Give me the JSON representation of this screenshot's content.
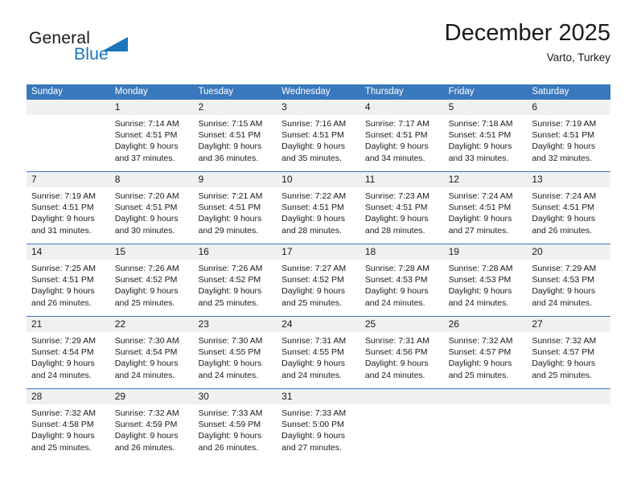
{
  "logo": {
    "text_general": "General",
    "text_blue": "Blue",
    "accent_color": "#1a75bb"
  },
  "header": {
    "title": "December 2025",
    "location": "Varto, Turkey"
  },
  "theme": {
    "header_bg": "#3a78bd",
    "daynum_bg": "#f0f0f0",
    "cell_bg": "#ffffff",
    "text": "#1a1a1a"
  },
  "calendar": {
    "weekday_headers": [
      "Sunday",
      "Monday",
      "Tuesday",
      "Wednesday",
      "Thursday",
      "Friday",
      "Saturday"
    ],
    "weeks": [
      [
        {
          "day": "",
          "lines": []
        },
        {
          "day": "1",
          "lines": [
            "Sunrise: 7:14 AM",
            "Sunset: 4:51 PM",
            "Daylight: 9 hours",
            "and 37 minutes."
          ]
        },
        {
          "day": "2",
          "lines": [
            "Sunrise: 7:15 AM",
            "Sunset: 4:51 PM",
            "Daylight: 9 hours",
            "and 36 minutes."
          ]
        },
        {
          "day": "3",
          "lines": [
            "Sunrise: 7:16 AM",
            "Sunset: 4:51 PM",
            "Daylight: 9 hours",
            "and 35 minutes."
          ]
        },
        {
          "day": "4",
          "lines": [
            "Sunrise: 7:17 AM",
            "Sunset: 4:51 PM",
            "Daylight: 9 hours",
            "and 34 minutes."
          ]
        },
        {
          "day": "5",
          "lines": [
            "Sunrise: 7:18 AM",
            "Sunset: 4:51 PM",
            "Daylight: 9 hours",
            "and 33 minutes."
          ]
        },
        {
          "day": "6",
          "lines": [
            "Sunrise: 7:19 AM",
            "Sunset: 4:51 PM",
            "Daylight: 9 hours",
            "and 32 minutes."
          ]
        }
      ],
      [
        {
          "day": "7",
          "lines": [
            "Sunrise: 7:19 AM",
            "Sunset: 4:51 PM",
            "Daylight: 9 hours",
            "and 31 minutes."
          ]
        },
        {
          "day": "8",
          "lines": [
            "Sunrise: 7:20 AM",
            "Sunset: 4:51 PM",
            "Daylight: 9 hours",
            "and 30 minutes."
          ]
        },
        {
          "day": "9",
          "lines": [
            "Sunrise: 7:21 AM",
            "Sunset: 4:51 PM",
            "Daylight: 9 hours",
            "and 29 minutes."
          ]
        },
        {
          "day": "10",
          "lines": [
            "Sunrise: 7:22 AM",
            "Sunset: 4:51 PM",
            "Daylight: 9 hours",
            "and 28 minutes."
          ]
        },
        {
          "day": "11",
          "lines": [
            "Sunrise: 7:23 AM",
            "Sunset: 4:51 PM",
            "Daylight: 9 hours",
            "and 28 minutes."
          ]
        },
        {
          "day": "12",
          "lines": [
            "Sunrise: 7:24 AM",
            "Sunset: 4:51 PM",
            "Daylight: 9 hours",
            "and 27 minutes."
          ]
        },
        {
          "day": "13",
          "lines": [
            "Sunrise: 7:24 AM",
            "Sunset: 4:51 PM",
            "Daylight: 9 hours",
            "and 26 minutes."
          ]
        }
      ],
      [
        {
          "day": "14",
          "lines": [
            "Sunrise: 7:25 AM",
            "Sunset: 4:51 PM",
            "Daylight: 9 hours",
            "and 26 minutes."
          ]
        },
        {
          "day": "15",
          "lines": [
            "Sunrise: 7:26 AM",
            "Sunset: 4:52 PM",
            "Daylight: 9 hours",
            "and 25 minutes."
          ]
        },
        {
          "day": "16",
          "lines": [
            "Sunrise: 7:26 AM",
            "Sunset: 4:52 PM",
            "Daylight: 9 hours",
            "and 25 minutes."
          ]
        },
        {
          "day": "17",
          "lines": [
            "Sunrise: 7:27 AM",
            "Sunset: 4:52 PM",
            "Daylight: 9 hours",
            "and 25 minutes."
          ]
        },
        {
          "day": "18",
          "lines": [
            "Sunrise: 7:28 AM",
            "Sunset: 4:53 PM",
            "Daylight: 9 hours",
            "and 24 minutes."
          ]
        },
        {
          "day": "19",
          "lines": [
            "Sunrise: 7:28 AM",
            "Sunset: 4:53 PM",
            "Daylight: 9 hours",
            "and 24 minutes."
          ]
        },
        {
          "day": "20",
          "lines": [
            "Sunrise: 7:29 AM",
            "Sunset: 4:53 PM",
            "Daylight: 9 hours",
            "and 24 minutes."
          ]
        }
      ],
      [
        {
          "day": "21",
          "lines": [
            "Sunrise: 7:29 AM",
            "Sunset: 4:54 PM",
            "Daylight: 9 hours",
            "and 24 minutes."
          ]
        },
        {
          "day": "22",
          "lines": [
            "Sunrise: 7:30 AM",
            "Sunset: 4:54 PM",
            "Daylight: 9 hours",
            "and 24 minutes."
          ]
        },
        {
          "day": "23",
          "lines": [
            "Sunrise: 7:30 AM",
            "Sunset: 4:55 PM",
            "Daylight: 9 hours",
            "and 24 minutes."
          ]
        },
        {
          "day": "24",
          "lines": [
            "Sunrise: 7:31 AM",
            "Sunset: 4:55 PM",
            "Daylight: 9 hours",
            "and 24 minutes."
          ]
        },
        {
          "day": "25",
          "lines": [
            "Sunrise: 7:31 AM",
            "Sunset: 4:56 PM",
            "Daylight: 9 hours",
            "and 24 minutes."
          ]
        },
        {
          "day": "26",
          "lines": [
            "Sunrise: 7:32 AM",
            "Sunset: 4:57 PM",
            "Daylight: 9 hours",
            "and 25 minutes."
          ]
        },
        {
          "day": "27",
          "lines": [
            "Sunrise: 7:32 AM",
            "Sunset: 4:57 PM",
            "Daylight: 9 hours",
            "and 25 minutes."
          ]
        }
      ],
      [
        {
          "day": "28",
          "lines": [
            "Sunrise: 7:32 AM",
            "Sunset: 4:58 PM",
            "Daylight: 9 hours",
            "and 25 minutes."
          ]
        },
        {
          "day": "29",
          "lines": [
            "Sunrise: 7:32 AM",
            "Sunset: 4:59 PM",
            "Daylight: 9 hours",
            "and 26 minutes."
          ]
        },
        {
          "day": "30",
          "lines": [
            "Sunrise: 7:33 AM",
            "Sunset: 4:59 PM",
            "Daylight: 9 hours",
            "and 26 minutes."
          ]
        },
        {
          "day": "31",
          "lines": [
            "Sunrise: 7:33 AM",
            "Sunset: 5:00 PM",
            "Daylight: 9 hours",
            "and 27 minutes."
          ]
        },
        {
          "day": "",
          "lines": []
        },
        {
          "day": "",
          "lines": []
        },
        {
          "day": "",
          "lines": []
        }
      ]
    ]
  }
}
